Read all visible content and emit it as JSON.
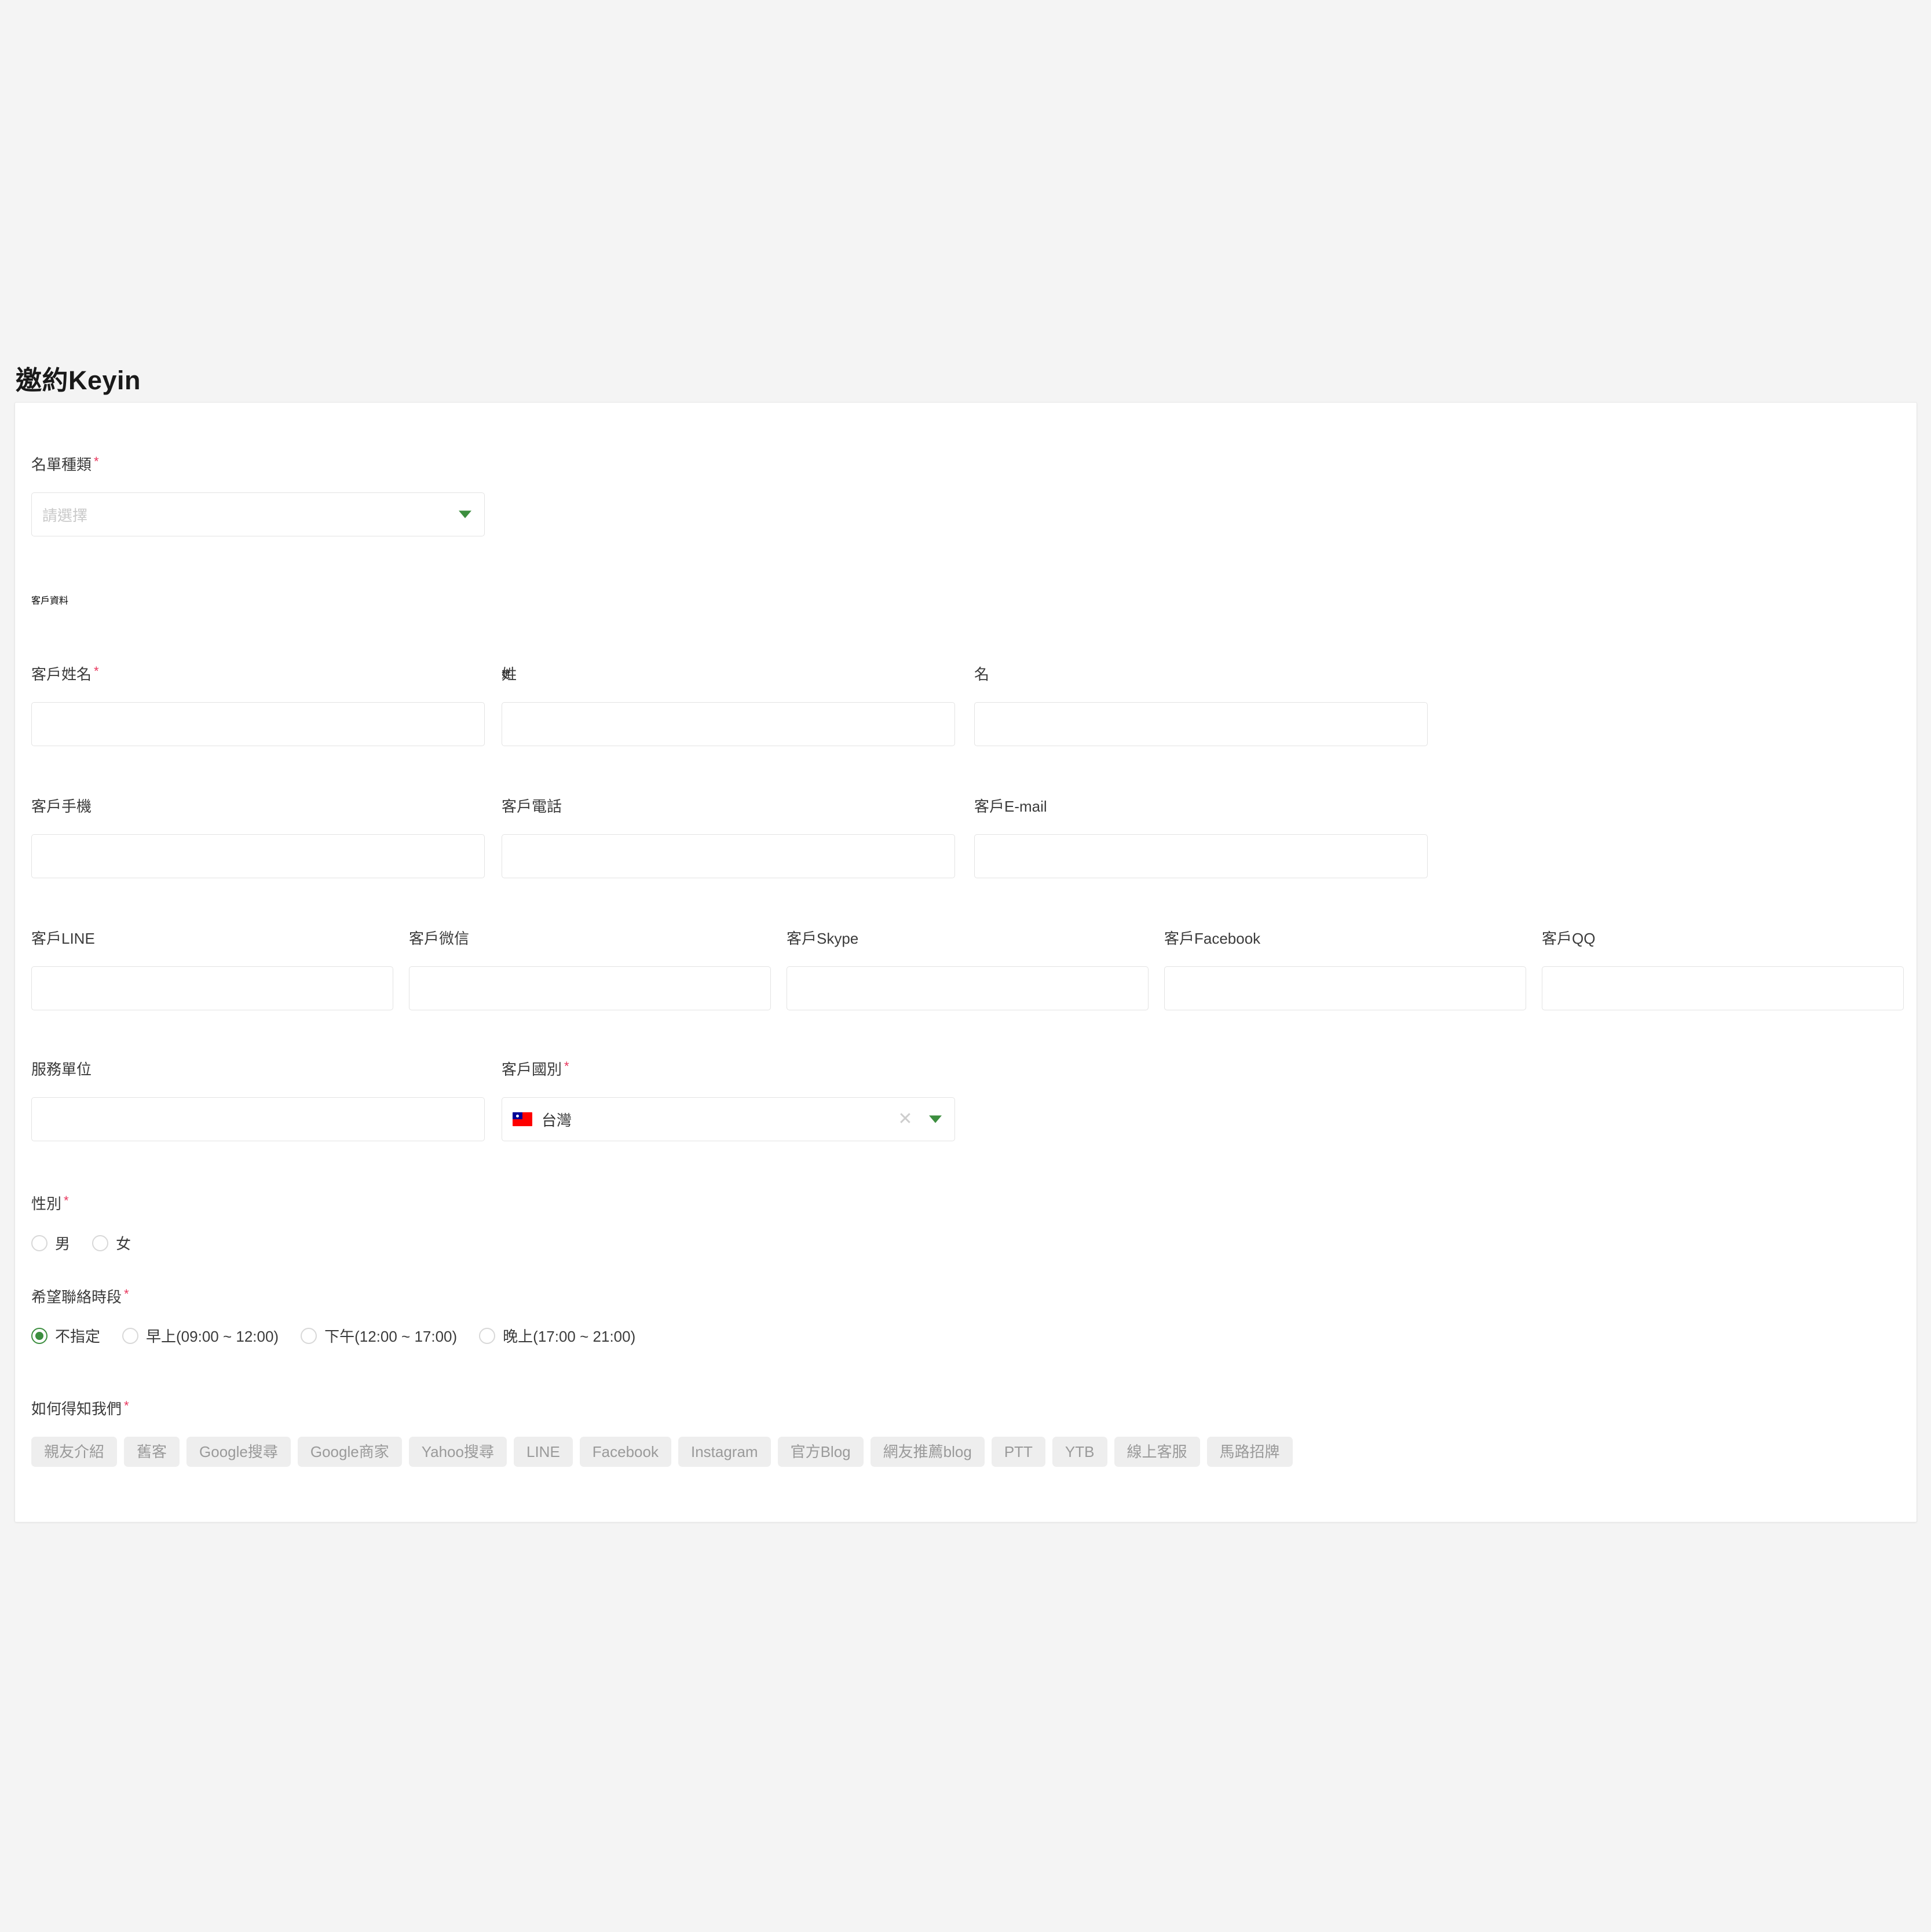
{
  "page": {
    "title": "邀約Keyin"
  },
  "list_type": {
    "label": "名單種類",
    "required_mark": "*",
    "placeholder": "請選擇",
    "value": ""
  },
  "customer_section": {
    "heading": "客戶資料"
  },
  "fields": {
    "customer_name": {
      "label": "客戶姓名",
      "required_mark": "*",
      "value": ""
    },
    "last_name": {
      "label": "姓",
      "value": ""
    },
    "first_name": {
      "label": "名",
      "value": ""
    },
    "mobile": {
      "label": "客戶手機",
      "value": ""
    },
    "phone": {
      "label": "客戶電話",
      "value": ""
    },
    "email": {
      "label": "客戶E-mail",
      "value": ""
    },
    "line": {
      "label": "客戶LINE",
      "value": ""
    },
    "wechat": {
      "label": "客戶微信",
      "value": ""
    },
    "skype": {
      "label": "客戶Skype",
      "value": ""
    },
    "facebook": {
      "label": "客戶Facebook",
      "value": ""
    },
    "qq": {
      "label": "客戶QQ",
      "value": ""
    },
    "service_unit": {
      "label": "服務單位",
      "value": ""
    },
    "country": {
      "label": "客戶國別",
      "required_mark": "*",
      "value": "台灣",
      "flag": "taiwan-flag",
      "clear_icon": "clear-x-icon",
      "caret_icon": "chevron-down-icon"
    }
  },
  "gender": {
    "label": "性別",
    "required_mark": "*",
    "options": [
      {
        "label": "男",
        "checked": false
      },
      {
        "label": "女",
        "checked": false
      }
    ]
  },
  "contact_time": {
    "label": "希望聯絡時段",
    "required_mark": "*",
    "options": [
      {
        "label": "不指定",
        "checked": true
      },
      {
        "label": "早上(09:00 ~ 12:00)",
        "checked": false
      },
      {
        "label": "下午(12:00 ~ 17:00)",
        "checked": false
      },
      {
        "label": "晚上(17:00 ~ 21:00)",
        "checked": false
      }
    ]
  },
  "source": {
    "label": "如何得知我們",
    "required_mark": "*",
    "tags": [
      "親友介紹",
      "舊客",
      "Google搜尋",
      "Google商家",
      "Yahoo搜尋",
      "LINE",
      "Facebook",
      "Instagram",
      "官方Blog",
      "網友推薦blog",
      "PTT",
      "YTB",
      "線上客服",
      "馬路招牌"
    ]
  },
  "colors": {
    "page_bg": "#f4f4f4",
    "card_bg": "#ffffff",
    "border": "#e3e3e3",
    "accent_green": "#3c8e3f",
    "required_red": "#e8365d",
    "chip_bg": "#eeeeee",
    "chip_text": "#9a9a9a"
  }
}
